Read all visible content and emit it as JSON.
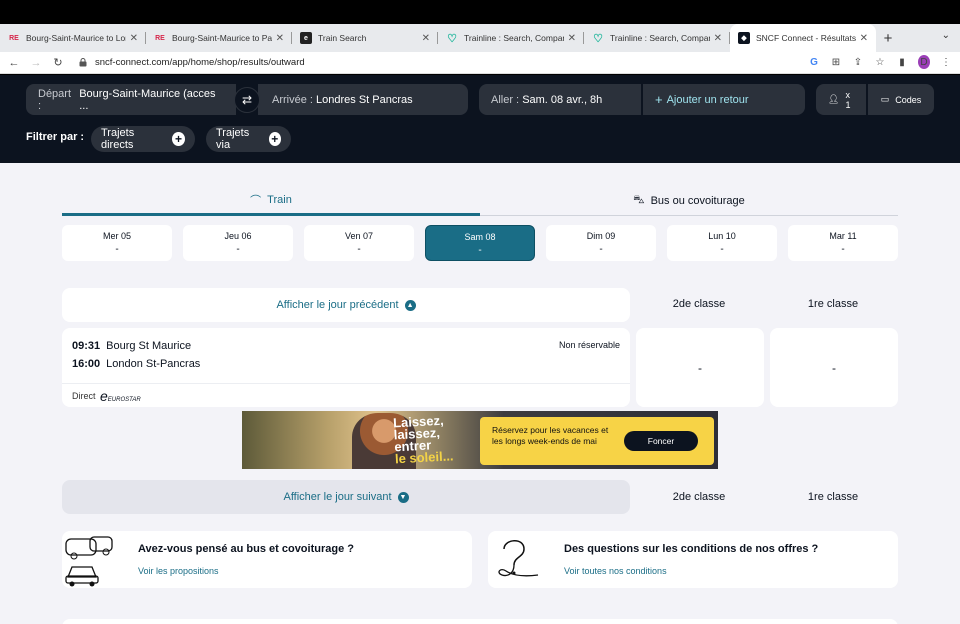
{
  "browser": {
    "tabs": [
      {
        "favicon": "RE",
        "title": "Bourg-Saint-Maurice to Lon",
        "active": false
      },
      {
        "favicon": "RE",
        "title": "Bourg-Saint-Maurice to Par",
        "active": false
      },
      {
        "favicon": "e",
        "title": "Train Search",
        "active": false
      },
      {
        "favicon": "heart",
        "title": "Trainline : Search, Compare",
        "active": false
      },
      {
        "favicon": "heart",
        "title": "Trainline : Search, Compare",
        "active": false
      },
      {
        "favicon": "sncf",
        "title": "SNCF Connect - Résultats d",
        "active": true
      }
    ],
    "url": "sncf-connect.com/app/home/shop/results/outward",
    "profile_initial": "D"
  },
  "search": {
    "depart_label": "Départ :",
    "depart_value": "Bourg-Saint-Maurice (acces ...",
    "arrivee_label": "Arrivée :",
    "arrivee_value": "Londres St Pancras",
    "aller_label": "Aller :",
    "aller_value": "Sam. 08 avr., 8h",
    "retour_label": "Ajouter un retour",
    "passengers": "x 1",
    "codes": "Codes"
  },
  "filters": {
    "label": "Filtrer par :",
    "chips": [
      "Trajets directs",
      "Trajets via"
    ]
  },
  "modes": {
    "train": "Train",
    "bus": "Bus ou covoiturage"
  },
  "days": [
    {
      "label": "Mer 05",
      "price": "-"
    },
    {
      "label": "Jeu 06",
      "price": "-"
    },
    {
      "label": "Ven 07",
      "price": "-"
    },
    {
      "label": "Sam 08",
      "price": "-"
    },
    {
      "label": "Dim 09",
      "price": "-"
    },
    {
      "label": "Lun 10",
      "price": "-"
    },
    {
      "label": "Mar 11",
      "price": "-"
    }
  ],
  "results": {
    "prev_label": "Afficher le jour précédent",
    "next_label": "Afficher le jour suivant",
    "class2": "2de classe",
    "class1": "1re classe",
    "journey": {
      "dep_time": "09:31",
      "dep_station": "Bourg St Maurice",
      "arr_time": "16:00",
      "arr_station": "London St-Pancras",
      "status": "Non réservable",
      "type": "Direct",
      "operator": "EUROSTAR",
      "price_2": "-",
      "price_1": "-"
    }
  },
  "banner": {
    "slogan1": "Laissez,",
    "slogan2": "laissez,",
    "slogan3": "entrer",
    "slogan4": "le soleil...",
    "text": "Réservez pour les vacances et les longs week-ends de mai",
    "cta": "Foncer"
  },
  "cards": {
    "bus_title": "Avez-vous pensé au bus et covoiturage ?",
    "bus_link": "Voir les propositions",
    "q_title": "Des questions sur les conditions de nos offres ?",
    "q_link": "Voir toutes nos conditions"
  }
}
